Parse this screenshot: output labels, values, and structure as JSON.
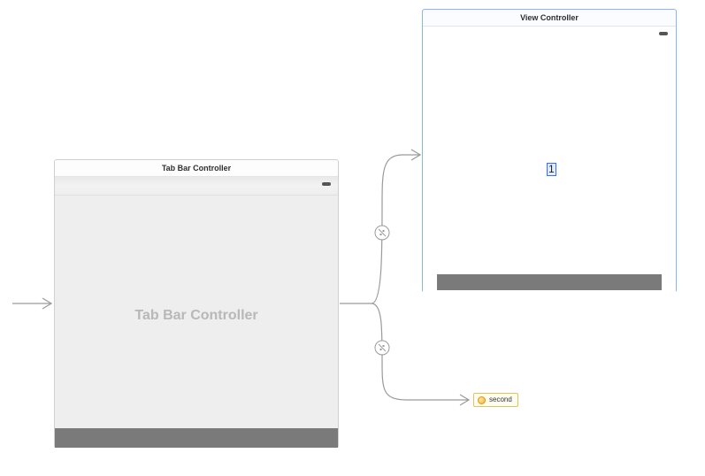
{
  "tab_bar_controller": {
    "title": "Tab Bar Controller",
    "watermark": "Tab Bar Controller"
  },
  "view_controller": {
    "title": "View Controller",
    "center_label": "1"
  },
  "second_item": {
    "label": "second"
  }
}
